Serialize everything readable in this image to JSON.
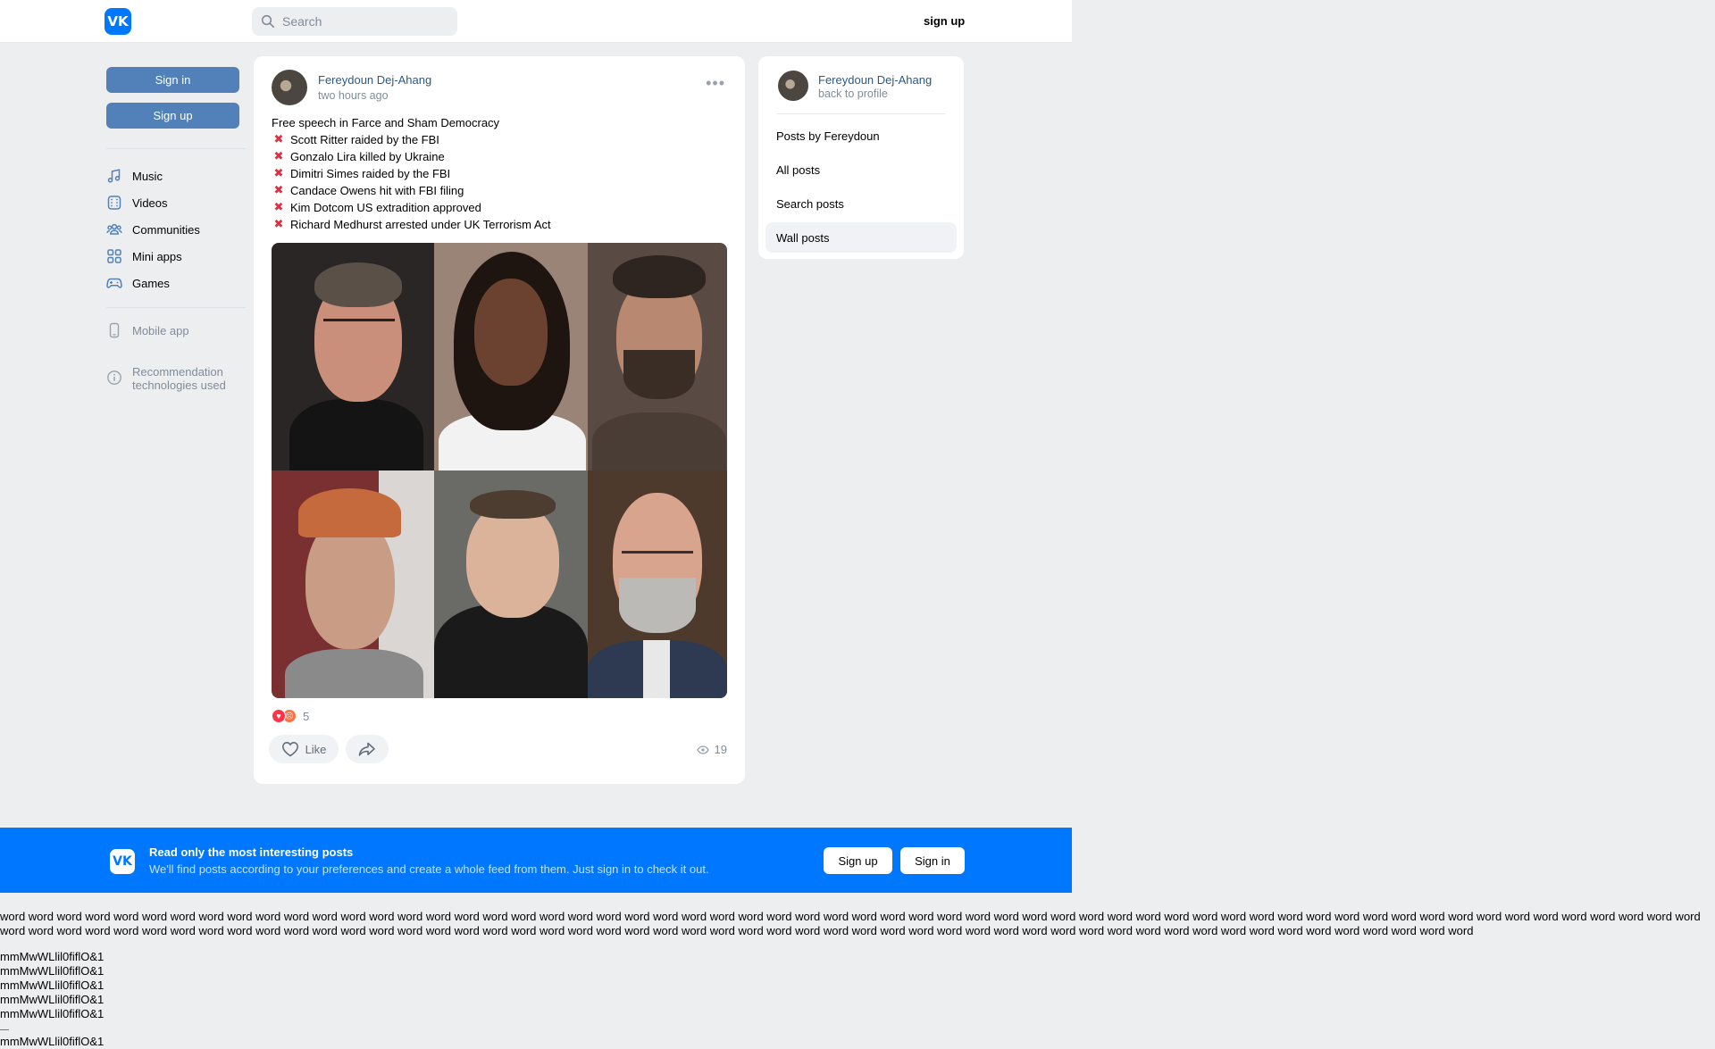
{
  "header": {
    "logo_text": "VK",
    "search_placeholder": "Search",
    "signup_link": "sign up"
  },
  "left": {
    "signin_label": "Sign in",
    "signup_label": "Sign up",
    "nav": [
      {
        "label": "Music",
        "icon": "music-icon"
      },
      {
        "label": "Videos",
        "icon": "video-icon"
      },
      {
        "label": "Communities",
        "icon": "communities-icon"
      },
      {
        "label": "Mini apps",
        "icon": "mini-apps-icon"
      },
      {
        "label": "Games",
        "icon": "gamepad-icon"
      }
    ],
    "mobile_app": "Mobile app",
    "recommendation_line1": "Recommendation",
    "recommendation_line2": "technologies used"
  },
  "post": {
    "author": "Fereydoun Dej-Ahang",
    "time": "two hours ago",
    "headline": "Free speech in Farce and Sham Democracy",
    "x_mark": "✖",
    "lines": [
      "Scott Ritter raided by the FBI",
      "Gonzalo Lira killed by Ukraine",
      "Dimitri Simes raided by the FBI",
      "Candace Owens hit with FBI filing",
      "Kim Dotcom US extradition approved",
      "Richard Medhurst arrested under UK Terrorism Act"
    ],
    "reaction_count": "5",
    "like_label": "Like",
    "views": "19"
  },
  "side": {
    "name": "Fereydoun Dej-Ahang",
    "back": "back to profile",
    "items": [
      "Posts by Fereydoun",
      "All posts",
      "Search posts",
      "Wall posts"
    ]
  },
  "banner": {
    "logo_text": "VK",
    "title": "Read only the most interesting posts",
    "subtitle": "We'll find posts according to your preferences and create a whole feed from them. Just sign in to check it out.",
    "signup_label": "Sign up",
    "signin_label": "Sign in"
  },
  "debug": {
    "word": "word",
    "word_count": 112,
    "glyph_line": "mmMwWLlil0fiflO&1",
    "glyph_lines_count": 5
  },
  "colors": {
    "vk_blue": "#0077ff",
    "button_blue": "#5181b8",
    "link_blue": "#2a5885",
    "background": "#edeef0"
  }
}
